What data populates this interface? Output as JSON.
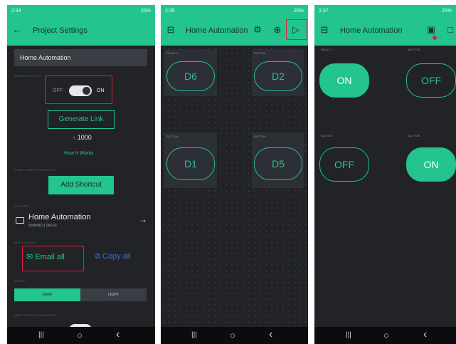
{
  "panel1": {
    "status": {
      "time": "2:34",
      "indicators": "▣ ✉ ⌕",
      "battery": "25%"
    },
    "title": "Project Settings",
    "project_name": "Home Automation",
    "shared_access": {
      "label": "SHARED ACCESS",
      "off": "OFF",
      "on": "ON"
    },
    "generate_link": "Generate Link",
    "energy": "1000",
    "how_it_works": "How It Works",
    "home_shortcut": {
      "label": "HOME SCREEN SHORTCUT",
      "button": "Add Shortcut"
    },
    "devices": {
      "label": "DEVICES",
      "name": "Home Automation",
      "sub": "NodeMCU (Wi-Fi)"
    },
    "auth_tokens": {
      "label": "AUTH TOKENS",
      "email": "Email all",
      "copy": "Copy all"
    },
    "theme": {
      "label": "THEME",
      "dark": "DARK",
      "light": "LIGHT"
    },
    "keep_screen": {
      "label": "KEEP SCREEN ALWAYS ON"
    }
  },
  "panel2": {
    "status": {
      "time": "2:35",
      "battery": "25%"
    },
    "title": "Home Automation",
    "widgets": [
      {
        "label": "RELAY 1",
        "value": "D6"
      },
      {
        "label": "BUTTON",
        "value": "D2"
      },
      {
        "label": "BUTTON",
        "value": "D1"
      },
      {
        "label": "BUTTON",
        "value": "D5"
      }
    ]
  },
  "panel3": {
    "status": {
      "time": "2:37",
      "battery": "25%"
    },
    "title": "Home Automation",
    "widgets": [
      {
        "label": "RELAY 1",
        "value": "ON"
      },
      {
        "label": "BUTTON",
        "value": "OFF"
      },
      {
        "label": "BUTTON",
        "value": "OFF"
      },
      {
        "label": "BUTTON",
        "value": "ON"
      }
    ]
  },
  "nav": {
    "recents": "|||",
    "home": "○",
    "back": "‹"
  },
  "colors": {
    "accent": "#23c48e",
    "dark_bg": "#212327",
    "highlight": "#e2213a"
  }
}
